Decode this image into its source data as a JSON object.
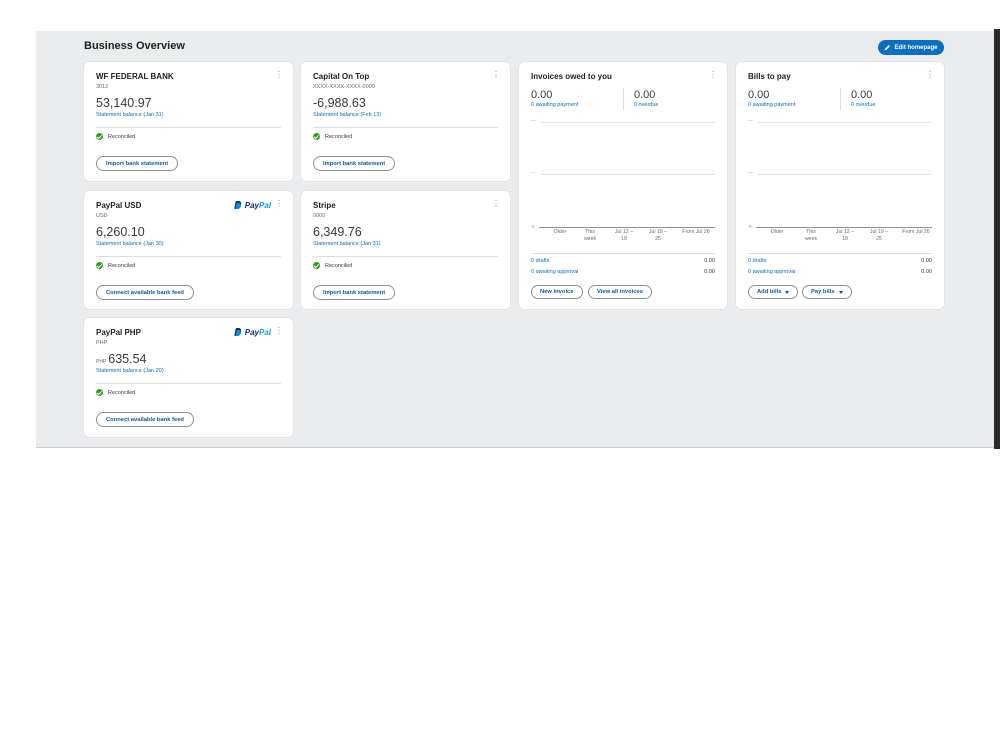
{
  "page": {
    "title": "Business Overview",
    "edit_button_label": "Edit homepage"
  },
  "accounts": [
    {
      "name": "WF FEDERAL BANK",
      "sub": "3012",
      "currency_prefix": "",
      "amount": "53,140.97",
      "statement": "Statement balance (Jan 31)",
      "status": "Reconciled",
      "action": "Import bank statement",
      "logo": ""
    },
    {
      "name": "Capital On Top",
      "sub": "XXXX-XXXX-XXXX-0000",
      "currency_prefix": "",
      "amount": "-6,988.63",
      "statement": "Statement balance (Feb 13)",
      "status": "Reconciled",
      "action": "Import bank statement",
      "logo": ""
    },
    {
      "name": "PayPal USD",
      "sub": "USD",
      "currency_prefix": "",
      "amount": "6,260.10",
      "statement": "Statement balance (Jan 30)",
      "status": "Reconciled",
      "action": "Connect available bank feed",
      "logo": "PayPal"
    },
    {
      "name": "Stripe",
      "sub": "0000",
      "currency_prefix": "",
      "amount": "6,349.76",
      "statement": "Statement balance (Jan 31)",
      "status": "Reconciled",
      "action": "Import bank statement",
      "logo": ""
    },
    {
      "name": "PayPal PHP",
      "sub": "PHP",
      "currency_prefix": "PHP",
      "amount": "635.54",
      "statement": "Statement balance (Jan 20)",
      "status": "Reconciled",
      "action": "Connect available bank feed",
      "logo": "PayPal"
    }
  ],
  "paypal_logo": {
    "pay": "Pay",
    "pal": "Pal"
  },
  "invoices": {
    "title": "Invoices owed to you",
    "metric1_value": "0.00",
    "metric1_label": "0 awaiting payment",
    "metric2_value": "0.00",
    "metric2_label": "0 overdue",
    "grid_tick": "—",
    "axis_zero": "0",
    "x_labels": [
      "Older",
      "This week",
      "Jul 12 – 18",
      "Jul 19 – 25",
      "From Jul 26"
    ],
    "row1_label": "0 drafts",
    "row1_value": "0.00",
    "row2_label": "0 awaiting approval",
    "row2_value": "0.00",
    "button1": "New invoice",
    "button2": "View all invoices"
  },
  "bills": {
    "title": "Bills to pay",
    "metric1_value": "0.00",
    "metric1_label": "0 awaiting payment",
    "metric2_value": "0.00",
    "metric2_label": "0 overdue",
    "grid_tick": "—",
    "axis_zero": "0",
    "x_labels": [
      "Older",
      "This week",
      "Jul 12 – 18",
      "Jul 19 – 25",
      "From Jul 26"
    ],
    "row1_label": "0 drafts",
    "row1_value": "0.00",
    "row2_label": "0 awaiting approval",
    "row2_value": "0.00",
    "button1": "Add bills",
    "button2": "Pay bills"
  },
  "colors": {
    "accent": "#0a6fc2",
    "reconciled": "#2ca01c",
    "panel_bg": "#eaecee"
  },
  "icons": [
    "pencil-icon",
    "kebab-menu-icon",
    "check-circle-icon",
    "paypal-logo",
    "caret-down-icon"
  ]
}
